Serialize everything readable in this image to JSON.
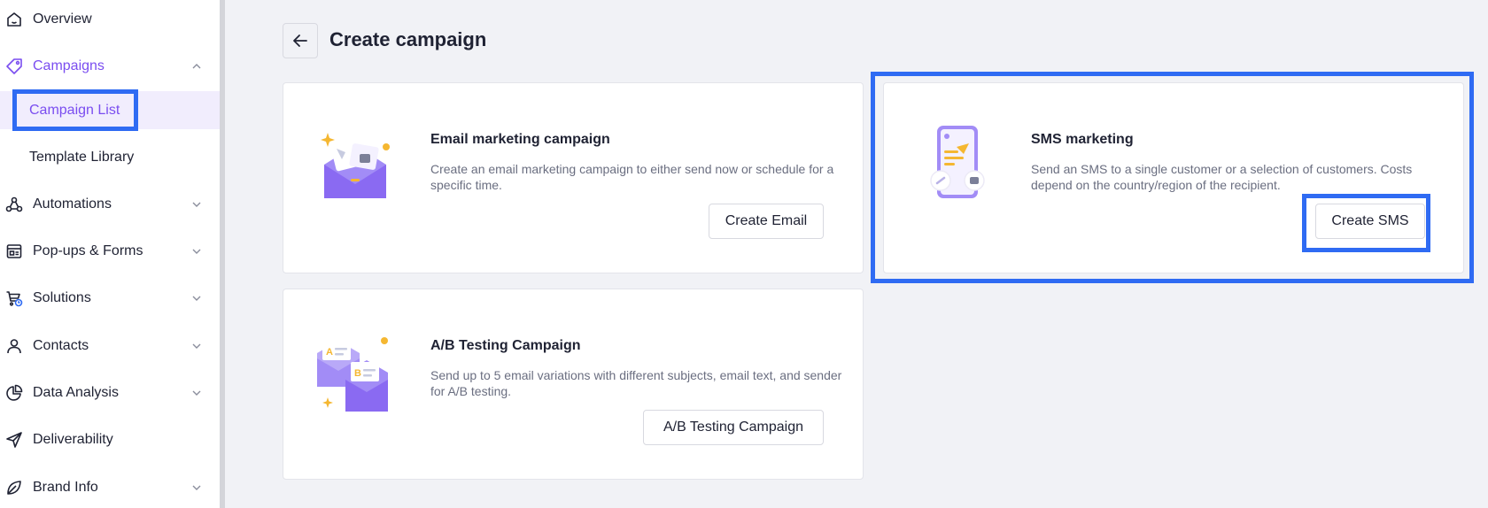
{
  "sidebar": {
    "items": [
      {
        "label": "Overview",
        "icon": "home-icon"
      },
      {
        "label": "Campaigns",
        "icon": "tag-icon",
        "expanded": true
      },
      {
        "label": "Automations",
        "icon": "automation-icon"
      },
      {
        "label": "Pop-ups & Forms",
        "icon": "form-icon"
      },
      {
        "label": "Solutions",
        "icon": "cart-icon"
      },
      {
        "label": "Contacts",
        "icon": "user-icon"
      },
      {
        "label": "Data Analysis",
        "icon": "pie-chart-icon"
      },
      {
        "label": "Deliverability",
        "icon": "send-icon"
      },
      {
        "label": "Brand Info",
        "icon": "leaf-icon"
      }
    ],
    "sub_items": [
      {
        "label": "Campaign List",
        "selected": true
      },
      {
        "label": "Template Library",
        "selected": false
      }
    ]
  },
  "header": {
    "back_icon": "arrow-left-icon",
    "title": "Create campaign"
  },
  "cards": {
    "email": {
      "title": "Email marketing campaign",
      "description": "Create an email marketing campaign to either send now or schedule for a specific time.",
      "button": "Create Email"
    },
    "sms": {
      "title": "SMS marketing",
      "description": "Send an SMS to a single customer or a selection of customers. Costs depend on the country/region of the recipient.",
      "button": "Create SMS"
    },
    "ab": {
      "title": "A/B Testing Campaign",
      "description": "Send up to 5 email variations with different subjects, email text, and sender for A/B testing.",
      "button": "A/B Testing Campaign"
    }
  },
  "colors": {
    "accent": "#7a4df0",
    "highlight": "#2f6bf3",
    "background": "#f1f2f6"
  }
}
